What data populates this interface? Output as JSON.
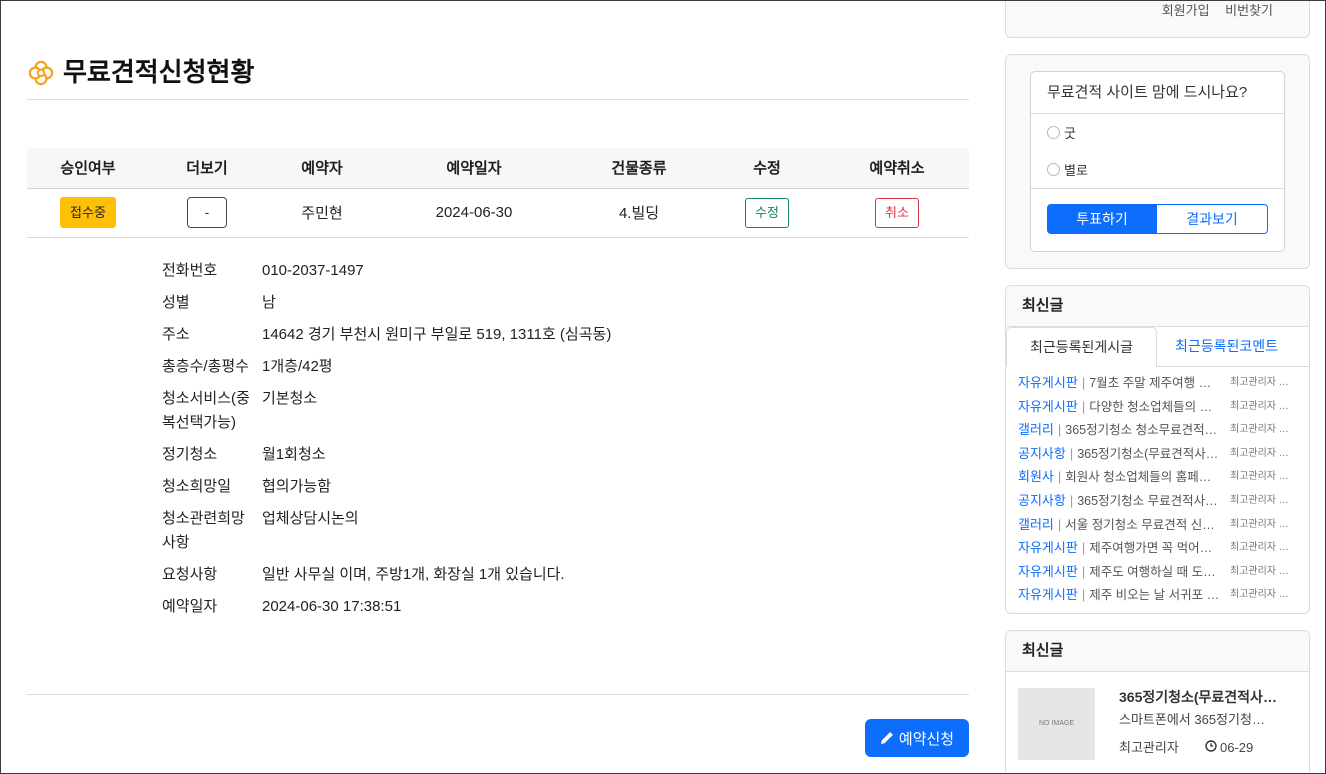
{
  "page": {
    "title": "무료견적신청현황",
    "title_icon": "flower-icon"
  },
  "colors": {
    "primary": "#0d6efd",
    "status_badge": "#ffc107",
    "edit": "#198754",
    "cancel": "#dc3545",
    "title_icon": "#f2a31b"
  },
  "reservation_table": {
    "headers": {
      "approval": "승인여부",
      "more": "더보기",
      "reserver": "예약자",
      "reserve_date": "예약일자",
      "building_type": "건물종류",
      "edit": "수정",
      "cancel": "예약취소"
    },
    "rows": [
      {
        "approval_status": "접수중",
        "more_toggle": "-",
        "reserver": "주민현",
        "reserve_date": "2024-06-30",
        "building_type": "4.빌딩",
        "edit_label": "수정",
        "cancel_label": "취소"
      }
    ]
  },
  "details": [
    {
      "label": "전화번호",
      "value": "010-2037-1497"
    },
    {
      "label": "성별",
      "value": "남"
    },
    {
      "label": "주소",
      "value": "14642 경기 부천시 원미구 부일로 519, 1311호 (심곡동)"
    },
    {
      "label": "총층수/총평수",
      "value": "1개층/42평"
    },
    {
      "label": "청소서비스(중복선택가능)",
      "value": "기본청소"
    },
    {
      "label": "정기청소",
      "value": "월1회청소"
    },
    {
      "label": "청소희망일",
      "value": "협의가능함"
    },
    {
      "label": "청소관련희망사항",
      "value": "업체상담시논의"
    },
    {
      "label": "요청사항",
      "value": "일반 사무실 이며, 주방1개, 화장실 1개 있습니다."
    },
    {
      "label": "예약일자",
      "value": "2024-06-30 17:38:51"
    }
  ],
  "actions": {
    "reserve_label": "예약신청",
    "reserve_icon": "pencil-icon"
  },
  "sidebar": {
    "member_links": {
      "join": "회원가입",
      "find_password": "비번찾기"
    },
    "poll": {
      "question": "무료견적 사이트 맘에 드시나요?",
      "options": [
        "굿",
        "별로"
      ],
      "vote_label": "투표하기",
      "results_label": "결과보기"
    },
    "latest_posts": {
      "title": "최신글",
      "tabs": [
        "최근등록된게시글",
        "최근등록된코멘트"
      ],
      "active_tab_index": 0,
      "separator": "|",
      "items": [
        {
          "board": "자유게시판",
          "subject": "7월초 주말 제주여행 …",
          "author": "최고관리자 …"
        },
        {
          "board": "자유게시판",
          "subject": "다양한 청소업체들의 …",
          "author": "최고관리자 …"
        },
        {
          "board": "갤러리",
          "subject": "365정기청소 청소무료견적…",
          "author": "최고관리자 …"
        },
        {
          "board": "공지사항",
          "subject": "365정기청소(무료견적사…",
          "author": "최고관리자 …"
        },
        {
          "board": "회원사",
          "subject": "회원사 청소업체들의 홈페…",
          "author": "최고관리자 …"
        },
        {
          "board": "공지사항",
          "subject": "365정기청소 무료견적사…",
          "author": "최고관리자 …"
        },
        {
          "board": "갤러리",
          "subject": "서울 정기청소 무료견적 신…",
          "author": "최고관리자 …"
        },
        {
          "board": "자유게시판",
          "subject": "제주여행가면 꼭 먹어…",
          "author": "최고관리자 …"
        },
        {
          "board": "자유게시판",
          "subject": "제주도 여행하실 때 도…",
          "author": "최고관리자 …"
        },
        {
          "board": "자유게시판",
          "subject": "제주 비오는 날 서귀포 …",
          "author": "최고관리자 …"
        }
      ]
    },
    "latest_gallery": {
      "title": "최신글",
      "item": {
        "thumbnail_text": "NO IMAGE",
        "title": "365정기청소(무료견적사…",
        "summary": "스마트폰에서 365정기청…",
        "author": "최고관리자",
        "date": "06-29",
        "date_icon": "clock-icon"
      }
    }
  }
}
